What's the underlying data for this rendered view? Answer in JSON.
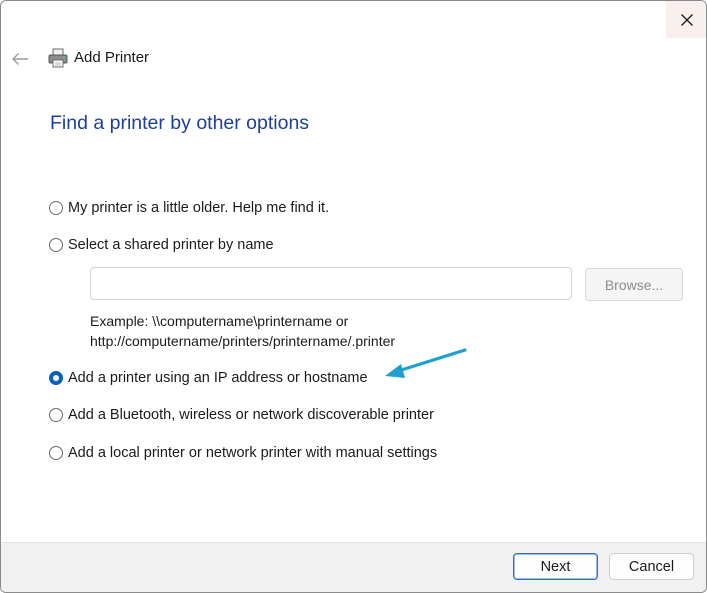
{
  "window": {
    "title": "Add Printer"
  },
  "heading": "Find a printer by other options",
  "options": [
    {
      "label": "My printer is a little older. Help me find it.",
      "checked": false
    },
    {
      "label": "Select a shared printer by name",
      "checked": false
    },
    {
      "label": "Add a printer using an IP address or hostname",
      "checked": true
    },
    {
      "label": "Add a Bluetooth, wireless or network discoverable printer",
      "checked": false
    },
    {
      "label": "Add a local printer or network printer with manual settings",
      "checked": false
    }
  ],
  "shared_printer": {
    "value": "",
    "browse_label": "Browse...",
    "example_line1": "Example: \\\\computername\\printername or",
    "example_line2": "http://computername/printers/printername/.printer"
  },
  "buttons": {
    "next": "Next",
    "cancel": "Cancel"
  },
  "colors": {
    "heading": "#1e3f9a",
    "accent": "#0a5fc0",
    "annotation_arrow": "#1ea0cf"
  },
  "icons": {
    "close": "close-icon",
    "back": "back-arrow-icon",
    "printer": "printer-icon",
    "annotation": "annotation-arrow"
  }
}
